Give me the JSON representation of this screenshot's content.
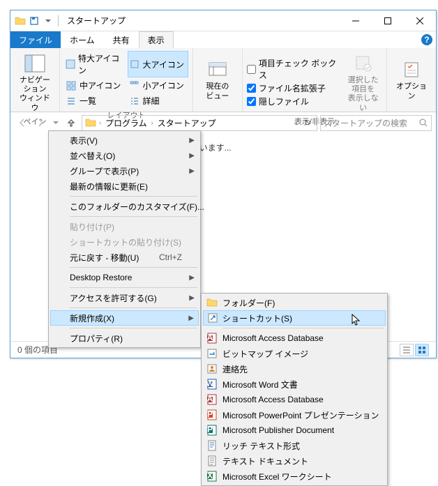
{
  "title": "スタートアップ",
  "tabs": {
    "file": "ファイル",
    "home": "ホーム",
    "share": "共有",
    "view": "表示"
  },
  "ribbon": {
    "pane": {
      "label": "ペイン",
      "nav": "ナビゲーション\nウィンドウ"
    },
    "layout": {
      "label": "レイアウト",
      "items": [
        "特大アイコン",
        "大アイコン",
        "中アイコン",
        "小アイコン",
        "一覧",
        "詳細"
      ]
    },
    "current": {
      "label": "現在の\nビュー"
    },
    "showhide": {
      "label": "表示/非表示",
      "chk1": "項目チェック ボックス",
      "chk2": "ファイル名拡張子",
      "chk3": "隠しファイル",
      "hide": "選択した項目を\n表示しない"
    },
    "options": "オプション"
  },
  "breadcrumb": {
    "seg1": "プログラム",
    "seg2": "スタートアップ"
  },
  "search_placeholder": "スタートアップの検索",
  "content_text": "置しています...",
  "status": "0 個の項目",
  "ctx1": {
    "view": "表示(V)",
    "sort": "並べ替え(O)",
    "group": "グループで表示(P)",
    "refresh": "最新の情報に更新(E)",
    "customize": "このフォルダーのカスタマイズ(F)...",
    "paste": "貼り付け(P)",
    "paste_shortcut": "ショートカットの貼り付け(S)",
    "undo": "元に戻す - 移動(U)",
    "undo_hot": "Ctrl+Z",
    "desktop_restore": "Desktop Restore",
    "access": "アクセスを許可する(G)",
    "new": "新規作成(X)",
    "properties": "プロパティ(R)"
  },
  "ctx2": {
    "folder": "フォルダー(F)",
    "shortcut": "ショートカット(S)",
    "access": "Microsoft Access Database",
    "bitmap": "ビットマップ イメージ",
    "contact": "連絡先",
    "word": "Microsoft Word 文書",
    "access2": "Microsoft Access Database",
    "ppt": "Microsoft PowerPoint プレゼンテーション",
    "publisher": "Microsoft Publisher Document",
    "rtf": "リッチ テキスト形式",
    "txt": "テキスト ドキュメント",
    "excel": "Microsoft Excel ワークシート"
  }
}
